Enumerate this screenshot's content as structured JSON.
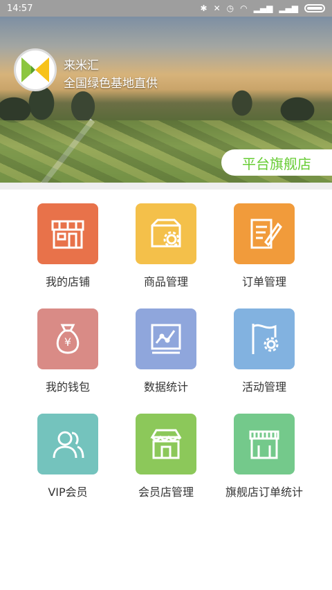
{
  "status_bar": {
    "time": "14:57"
  },
  "header": {
    "brand_name": "来米汇",
    "slogan": "全国绿色基地直供",
    "flagship_tag": "平台旗舰店"
  },
  "menu": {
    "items": [
      {
        "label": "我的店铺",
        "icon": "storefront-icon",
        "color": "#e8724a"
      },
      {
        "label": "商品管理",
        "icon": "product-settings-icon",
        "color": "#f4c04a"
      },
      {
        "label": "订单管理",
        "icon": "order-edit-icon",
        "color": "#f19b3b"
      },
      {
        "label": "我的钱包",
        "icon": "money-bag-icon",
        "color": "#d98b86"
      },
      {
        "label": "数据统计",
        "icon": "line-chart-icon",
        "color": "#8fa6dc"
      },
      {
        "label": "活动管理",
        "icon": "flag-gear-icon",
        "color": "#82b2e0"
      },
      {
        "label": "VIP会员",
        "icon": "vip-users-icon",
        "color": "#74c3bd"
      },
      {
        "label": "会员店管理",
        "icon": "member-store-icon",
        "color": "#8cc85a"
      },
      {
        "label": "旗舰店订单统计",
        "icon": "shop-awning-icon",
        "color": "#74c98b"
      }
    ]
  }
}
